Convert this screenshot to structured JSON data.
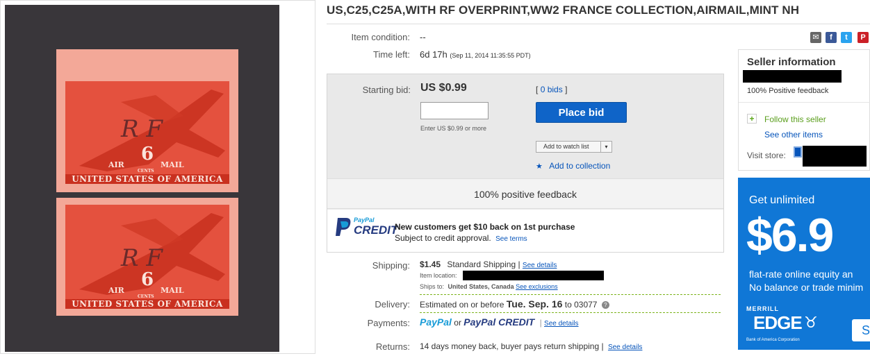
{
  "title": "US,C25,C25A,WITH RF OVERPRINT,WW2 FRANCE COLLECTION,AIRMAIL,MINT NH",
  "condition": {
    "label": "Item condition:",
    "value": "--"
  },
  "time_left": {
    "label": "Time left:",
    "value": "6d 17h",
    "detail": "(Sep 11, 2014   11:35:55 PDT)"
  },
  "bid": {
    "label": "Starting bid:",
    "price": "US $0.99",
    "bids_prefix": "[",
    "bids_link": "0 bids",
    "bids_suffix": "]",
    "input_hint": "Enter US $0.99 or more",
    "place_bid": "Place bid",
    "watch_label": "Add to watch list",
    "collection": "Add to collection",
    "feedback": "100% positive feedback"
  },
  "credit": {
    "paypal": "PayPal",
    "credit": "CREDIT",
    "headline": "New customers get $10 back on 1st purchase",
    "sub": "Subject to credit approval.",
    "terms": "See terms"
  },
  "shipping": {
    "label": "Shipping:",
    "price": "$1.45",
    "method": "Standard Shipping |",
    "details": "See details",
    "location_label": "Item location:",
    "ships_to_label": "Ships to:",
    "ships_to": "United States, Canada",
    "exclusions": "See exclusions"
  },
  "delivery": {
    "label": "Delivery:",
    "prefix": "Estimated on or before",
    "date": "Tue. Sep. 16",
    "to": "to 03077"
  },
  "payments": {
    "label": "Payments:",
    "paypal": "PayPal",
    "or": "or",
    "paypal_credit": "PayPal CREDIT",
    "sep": "|",
    "details": "See details"
  },
  "returns": {
    "label": "Returns:",
    "value": "14 days money back, buyer pays return shipping |",
    "details": "See details"
  },
  "seller": {
    "heading": "Seller information",
    "feedback": "100% Positive feedback",
    "follow": "Follow this seller",
    "other": "See other items",
    "visit": "Visit store:"
  },
  "ad": {
    "line1": "Get unlimited",
    "price": "$6.9",
    "line2": "flat-rate online equity an",
    "line3": "No balance or trade minim",
    "brand_top": "MERRILL",
    "brand": "EDGE",
    "brand_sub": "Bank of America Corporation",
    "cta": "S"
  },
  "stamp": {
    "air": "AIR",
    "six": "6",
    "mail": "MAIL",
    "cents": "CENTS",
    "band": "UNITED STATES OF AMERICA",
    "overprint": "R F"
  },
  "share": {
    "mail": "✉",
    "facebook": "f",
    "twitter": "t",
    "pinterest": "P"
  },
  "colors": {
    "accent": "#0654ba",
    "button": "#0f64c8",
    "ad": "#1077d6",
    "stamp": "#e4513e"
  }
}
